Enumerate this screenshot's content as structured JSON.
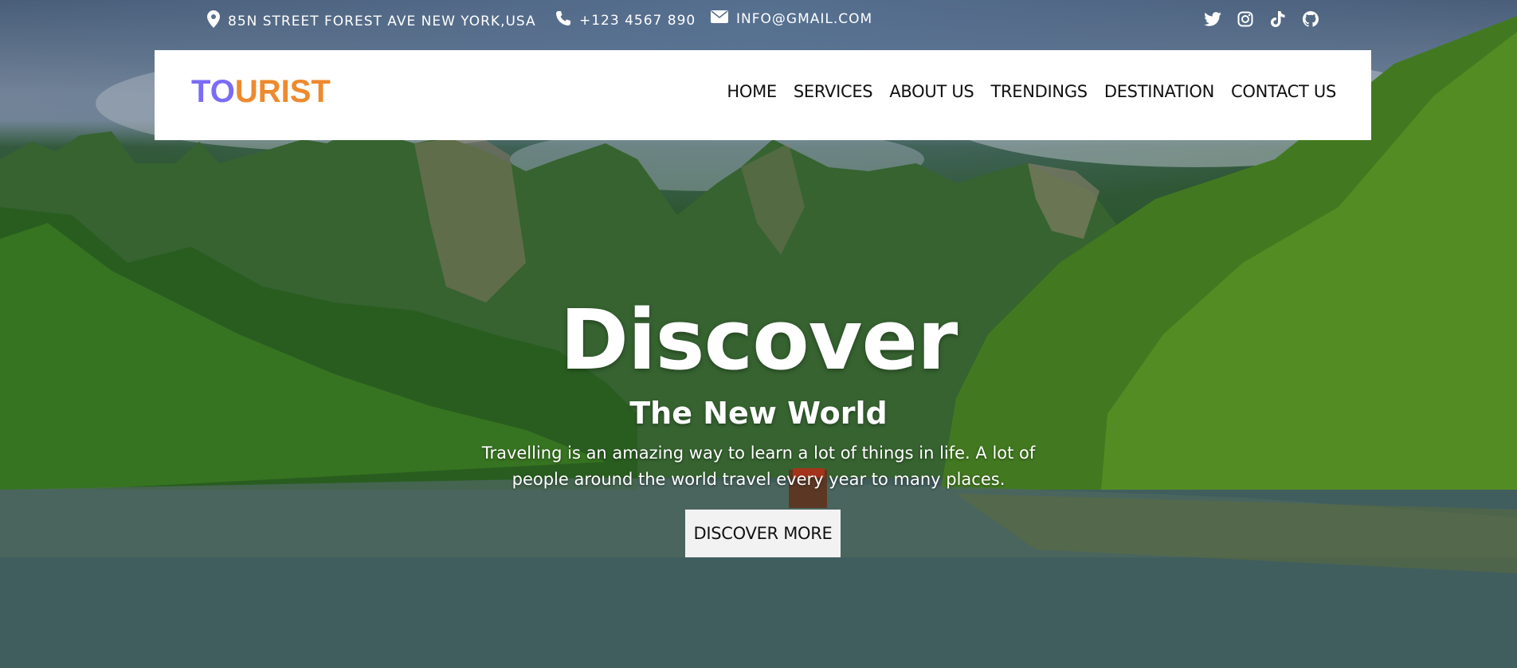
{
  "topbar": {
    "address": "85N STREET FOREST AVE NEW YORK,USA",
    "phone": "+123 4567 890",
    "email": "INFO@GMAIL.COM",
    "icons": [
      "map-pin-icon",
      "phone-icon",
      "envelope-icon"
    ],
    "socials": [
      "twitter-icon",
      "instagram-icon",
      "tiktok-icon",
      "github-icon"
    ]
  },
  "navbar": {
    "logo_part1": "TO",
    "logo_part2": "URIST",
    "menu": [
      "HOME",
      "SERVICES",
      "ABOUT US",
      "TRENDINGS",
      "DESTINATION",
      "CONTACT US"
    ]
  },
  "hero": {
    "title": "Discover",
    "subtitle": "The New World",
    "description": "Travelling is an amazing way to learn a lot of things in life. A lot of people around the world travel every year to many places.",
    "cta_label": "DISCOVER MORE"
  },
  "colors": {
    "logo_primary": "#7b6cf6",
    "logo_secondary": "#ee8a2e",
    "button_bg": "#f2f2f2"
  }
}
